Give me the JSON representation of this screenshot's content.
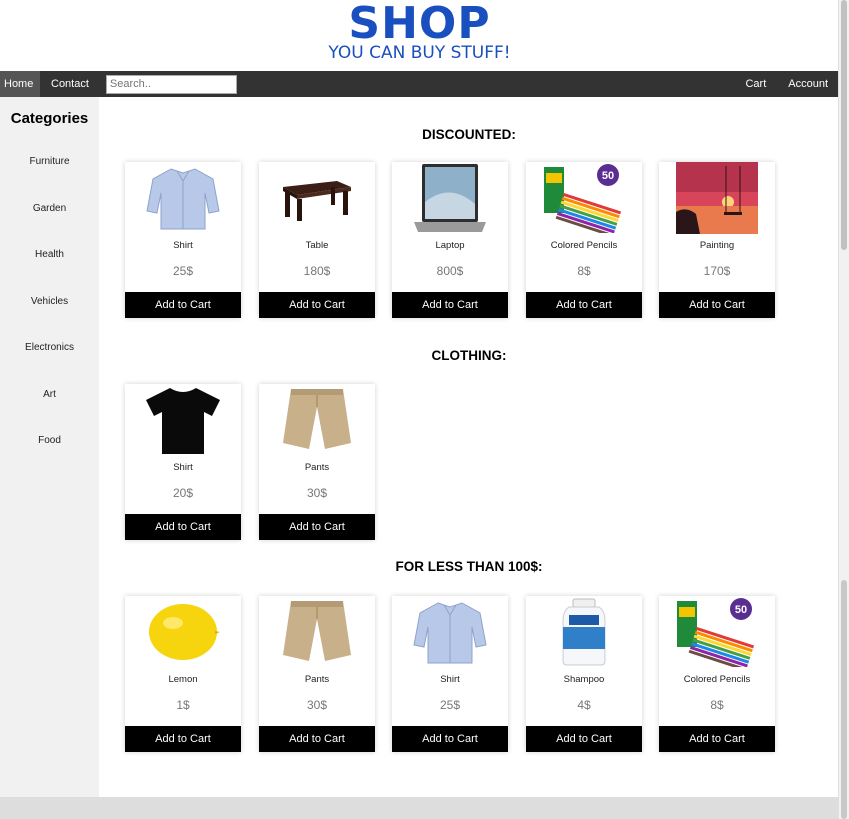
{
  "logo": {
    "title": "SHOP",
    "subtitle": "YOU CAN BUY STUFF!"
  },
  "nav": {
    "home": "Home",
    "contact": "Contact",
    "search_placeholder": "Search..",
    "cart": "Cart",
    "account": "Account"
  },
  "sidebar": {
    "title": "Categories",
    "items": [
      "Furniture",
      "Garden",
      "Health",
      "Vehicles",
      "Electronics",
      "Art",
      "Food"
    ]
  },
  "button_label": "Add to Cart",
  "sections": [
    {
      "title": "DISCOUNTED:",
      "products": [
        {
          "name": "Shirt",
          "price": "25$",
          "icon": "blue-shirt-icon"
        },
        {
          "name": "Table",
          "price": "180$",
          "icon": "table-icon"
        },
        {
          "name": "Laptop",
          "price": "800$",
          "icon": "laptop-icon"
        },
        {
          "name": "Colored Pencils",
          "price": "8$",
          "icon": "colored-pencils-icon"
        },
        {
          "name": "Painting",
          "price": "170$",
          "icon": "painting-icon"
        }
      ]
    },
    {
      "title": "CLOTHING:",
      "products": [
        {
          "name": "Shirt",
          "price": "20$",
          "icon": "black-tshirt-icon"
        },
        {
          "name": "Pants",
          "price": "30$",
          "icon": "pants-icon"
        }
      ]
    },
    {
      "title": "FOR LESS THAN 100$:",
      "products": [
        {
          "name": "Lemon",
          "price": "1$",
          "icon": "lemon-icon"
        },
        {
          "name": "Pants",
          "price": "30$",
          "icon": "pants-icon"
        },
        {
          "name": "Shirt",
          "price": "25$",
          "icon": "blue-shirt-icon"
        },
        {
          "name": "Shampoo",
          "price": "4$",
          "icon": "shampoo-icon"
        },
        {
          "name": "Colored Pencils",
          "price": "8$",
          "icon": "colored-pencils-icon"
        }
      ]
    }
  ],
  "colors": {
    "brand": "#1a4fbf",
    "nav_bg": "#333333",
    "button_bg": "#000000",
    "sidebar_bg": "#f1f1f1"
  }
}
